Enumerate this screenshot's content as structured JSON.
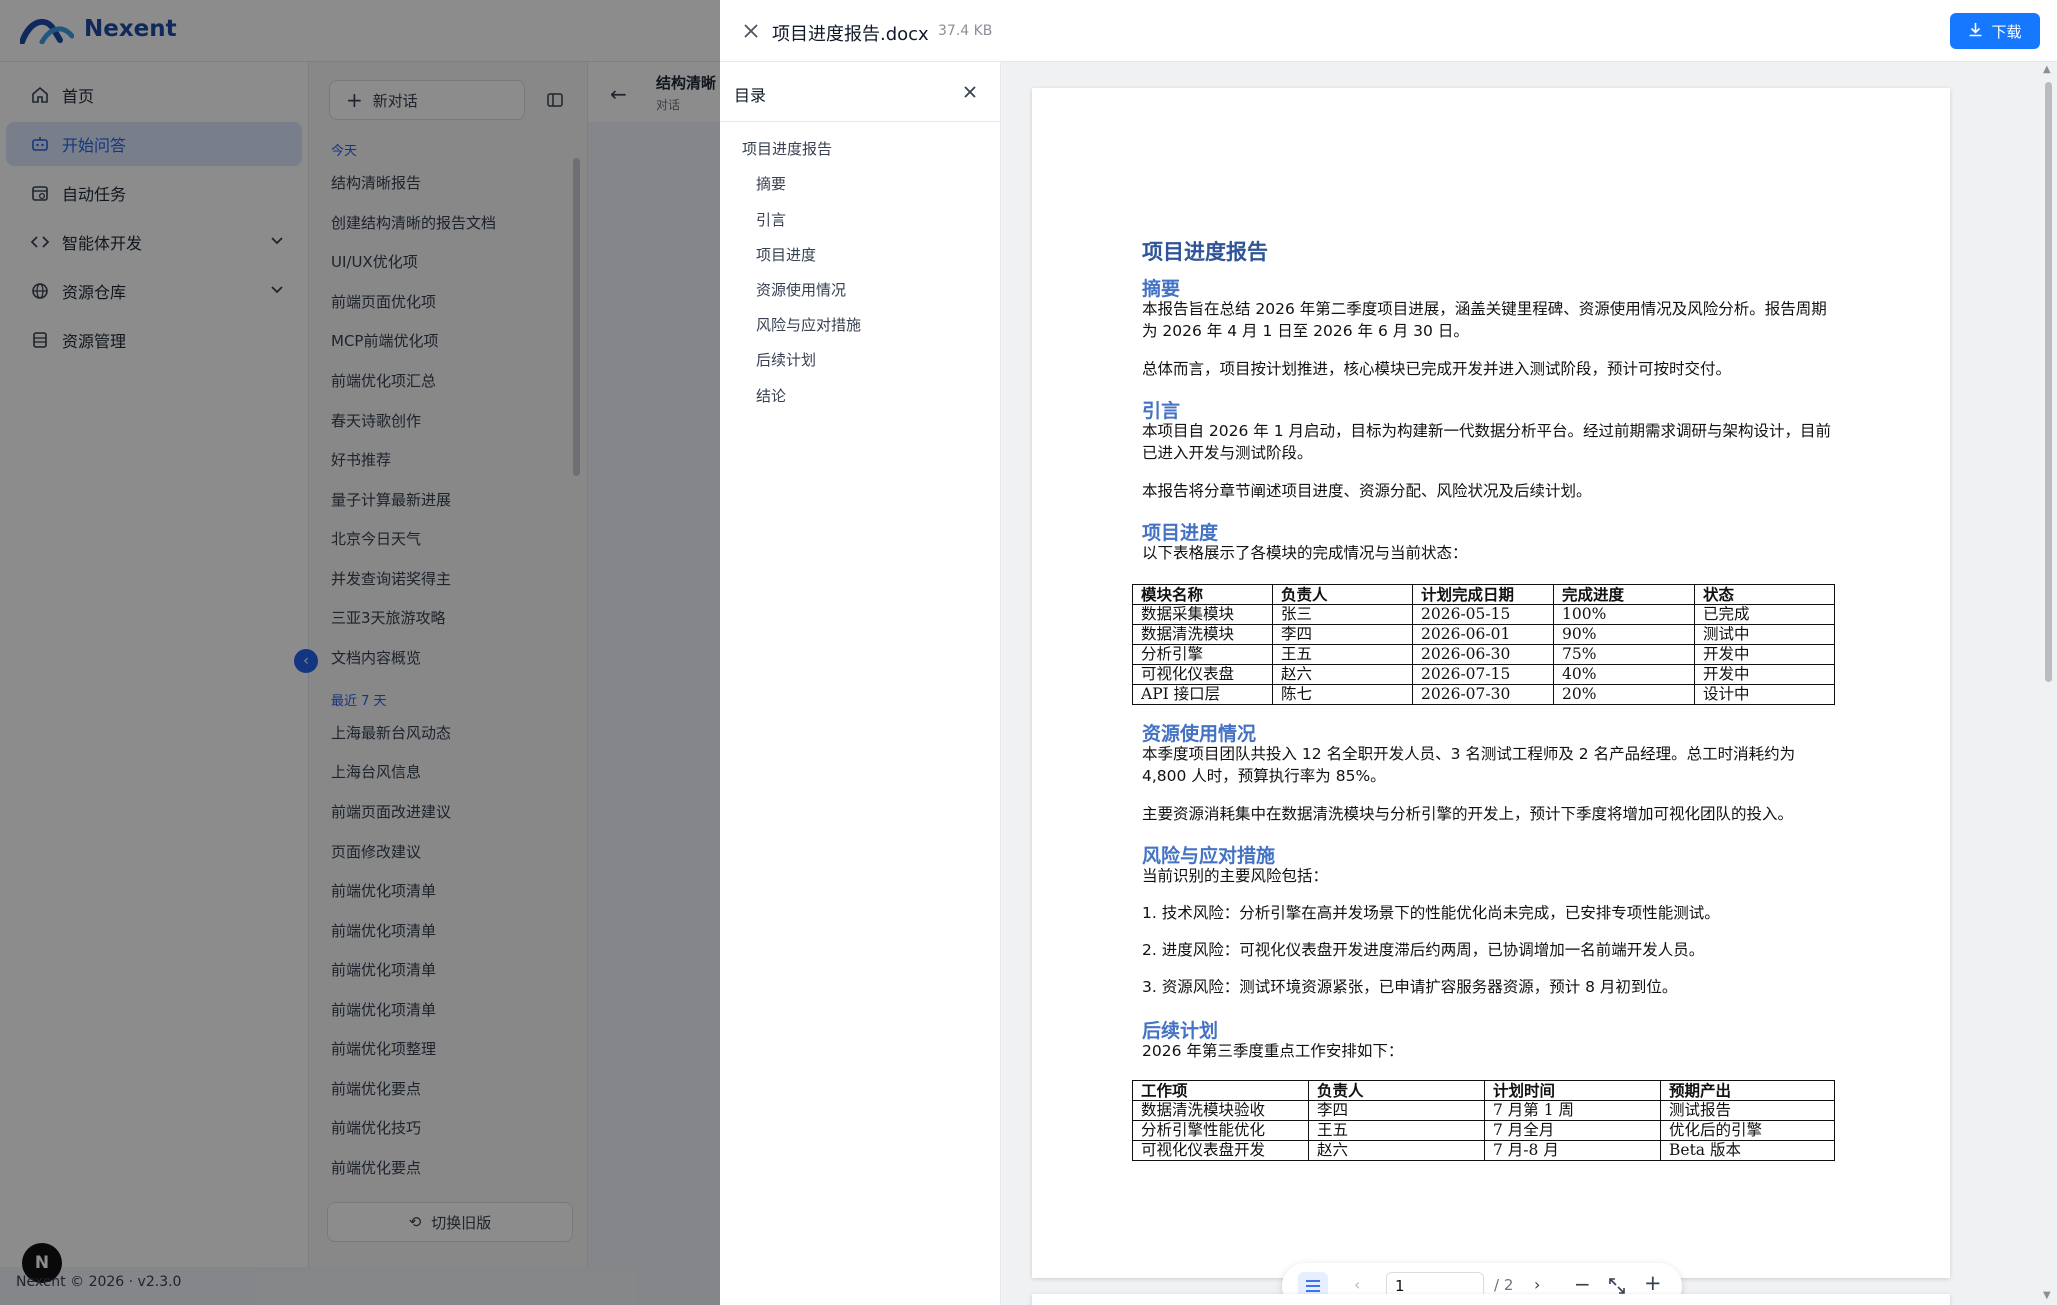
{
  "app": {
    "name": "Nexent",
    "footer": "Nexent © 2026 · v2.3.0",
    "avatar_letter": "N"
  },
  "nav": {
    "items": [
      {
        "label": "首页",
        "icon": "home-icon"
      },
      {
        "label": "开始问答",
        "icon": "chat-bot-icon"
      },
      {
        "label": "自动任务",
        "icon": "calendar-clock-icon"
      },
      {
        "label": "智能体开发",
        "icon": "code-icon"
      },
      {
        "label": "资源仓库",
        "icon": "globe-icon"
      },
      {
        "label": "资源管理",
        "icon": "database-icon"
      }
    ]
  },
  "conversations": {
    "new_chat": "新对话",
    "today_label": "今天",
    "today": [
      "结构清晰报告",
      "创建结构清晰的报告文档",
      "UI/UX优化项",
      "前端页面优化项",
      "MCP前端优化项",
      "前端优化项汇总",
      "春天诗歌创作",
      "好书推荐",
      "量子计算最新进展",
      "北京今日天气",
      "并发查询诺奖得主",
      "三亚3天旅游攻略",
      "文档内容概览"
    ],
    "week_label": "最近 7 天",
    "week": [
      "上海最新台风动态",
      "上海台风信息",
      "前端页面改进建议",
      "页面修改建议",
      "前端优化项清单",
      "前端优化项清单",
      "前端优化项清单",
      "前端优化项清单",
      "前端优化项整理",
      "前端优化要点",
      "前端优化技巧",
      "前端优化要点"
    ],
    "switch_old": "切换旧版"
  },
  "chat_header": {
    "title": "结构清晰",
    "subtitle": "对话"
  },
  "preview": {
    "file_name": "项目进度报告.docx",
    "file_size": "37.4 KB",
    "download_label": "下载",
    "toc_title": "目录",
    "toc": [
      {
        "label": "项目进度报告",
        "level": 1
      },
      {
        "label": "摘要",
        "level": 2
      },
      {
        "label": "引言",
        "level": 2
      },
      {
        "label": "项目进度",
        "level": 2
      },
      {
        "label": "资源使用情况",
        "level": 2
      },
      {
        "label": "风险与应对措施",
        "level": 2
      },
      {
        "label": "后续计划",
        "level": 2
      },
      {
        "label": "结论",
        "level": 2
      }
    ],
    "pager": {
      "current": "1",
      "total": "/ 2"
    }
  },
  "doc": {
    "title": "项目进度报告",
    "s1_title": "摘要",
    "s1_p1": "本报告旨在总结 2026 年第二季度项目进展，涵盖关键里程碑、资源使用情况及风险分析。报告周期为 2026 年 4 月 1 日至 2026 年 6 月 30 日。",
    "s1_p2": "总体而言，项目按计划推进，核心模块已完成开发并进入测试阶段，预计可按时交付。",
    "s2_title": "引言",
    "s2_p1": "本项目自 2026 年 1 月启动，目标为构建新一代数据分析平台。经过前期需求调研与架构设计，目前已进入开发与测试阶段。",
    "s2_p2": "本报告将分章节阐述项目进度、资源分配、风险状况及后续计划。",
    "s3_title": "项目进度",
    "s3_p1": "以下表格展示了各模块的完成情况与当前状态：",
    "table1": {
      "headers": [
        "模块名称",
        "负责人",
        "计划完成日期",
        "完成进度",
        "状态"
      ],
      "rows": [
        [
          "数据采集模块",
          "张三",
          "2026-05-15",
          "100%",
          "已完成"
        ],
        [
          "数据清洗模块",
          "李四",
          "2026-06-01",
          "90%",
          "测试中"
        ],
        [
          "分析引擎",
          "王五",
          "2026-06-30",
          "75%",
          "开发中"
        ],
        [
          "可视化仪表盘",
          "赵六",
          "2026-07-15",
          "40%",
          "开发中"
        ],
        [
          "API 接口层",
          "陈七",
          "2026-07-30",
          "20%",
          "设计中"
        ]
      ]
    },
    "s4_title": "资源使用情况",
    "s4_p1": "本季度项目团队共投入 12 名全职开发人员、3 名测试工程师及 2 名产品经理。总工时消耗约为 4,800 人时，预算执行率为 85%。",
    "s4_p2": "主要资源消耗集中在数据清洗模块与分析引擎的开发上，预计下季度将增加可视化团队的投入。",
    "s5_title": "风险与应对措施",
    "s5_p1": "当前识别的主要风险包括：",
    "s5_l1": "1. 技术风险：分析引擎在高并发场景下的性能优化尚未完成，已安排专项性能测试。",
    "s5_l2": "2. 进度风险：可视化仪表盘开发进度滞后约两周，已协调增加一名前端开发人员。",
    "s5_l3": "3. 资源风险：测试环境资源紧张，已申请扩容服务器资源，预计 8 月初到位。",
    "s6_title": "后续计划",
    "s6_p1": "2026 年第三季度重点工作安排如下：",
    "table2": {
      "headers": [
        "工作项",
        "负责人",
        "计划时间",
        "预期产出"
      ],
      "rows": [
        [
          "数据清洗模块验收",
          "李四",
          "7 月第 1 周",
          "测试报告"
        ],
        [
          "分析引擎性能优化",
          "王五",
          "7 月全月",
          "优化后的引擎"
        ],
        [
          "可视化仪表盘开发",
          "赵六",
          "7 月-8 月",
          "Beta 版本"
        ]
      ]
    }
  }
}
